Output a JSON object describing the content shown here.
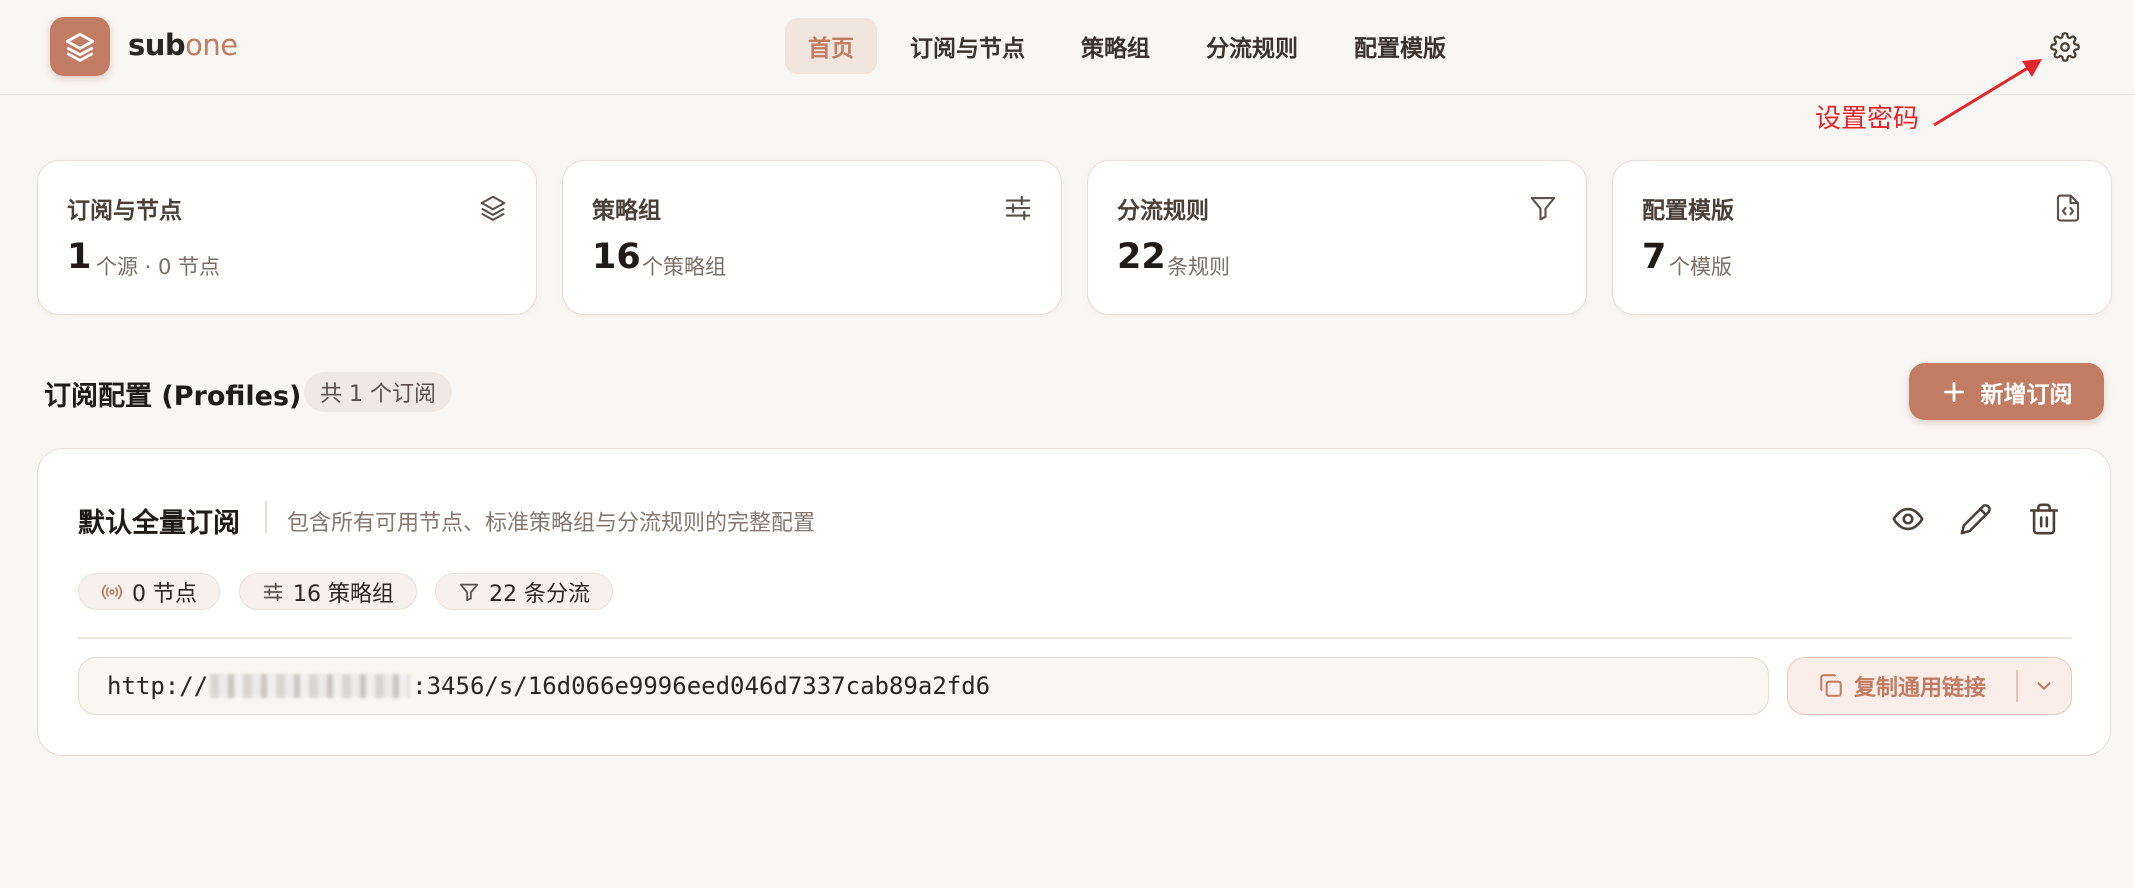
{
  "brand": {
    "part1": "sub",
    "part2": "one"
  },
  "nav": [
    {
      "label": "首页",
      "active": true
    },
    {
      "label": "订阅与节点",
      "active": false
    },
    {
      "label": "策略组",
      "active": false
    },
    {
      "label": "分流规则",
      "active": false
    },
    {
      "label": "配置模版",
      "active": false
    }
  ],
  "annotation": {
    "text": "设置密码",
    "color": "#e3262a"
  },
  "stats": [
    {
      "title": "订阅与节点",
      "value": "1",
      "unit": "个源 · 0 节点",
      "icon": "layers-icon"
    },
    {
      "title": "策略组",
      "value": "16",
      "unit": "个策略组",
      "icon": "sliders-icon"
    },
    {
      "title": "分流规则",
      "value": "22",
      "unit": "条规则",
      "icon": "filter-icon"
    },
    {
      "title": "配置模版",
      "value": "7",
      "unit": "个模版",
      "icon": "file-code-icon"
    }
  ],
  "profiles": {
    "title": "订阅配置 (Profiles)",
    "count_label": "共 1 个订阅",
    "add_label": "新增订阅",
    "card": {
      "name": "默认全量订阅",
      "description": "包含所有可用节点、标准策略组与分流规则的完整配置",
      "tags": [
        {
          "label": "0 节点",
          "icon": "broadcast-icon"
        },
        {
          "label": "16 策略组",
          "icon": "sliders-icon"
        },
        {
          "label": "22 条分流",
          "icon": "filter-icon"
        }
      ],
      "url_prefix": "http://",
      "url_suffix": ":3456/s/16d066e9996eed046d7337cab89a2fd6",
      "copy_label": "复制通用链接"
    }
  },
  "colors": {
    "accent": "#c27c63",
    "background": "#f9f7f4",
    "card": "#ffffff"
  }
}
